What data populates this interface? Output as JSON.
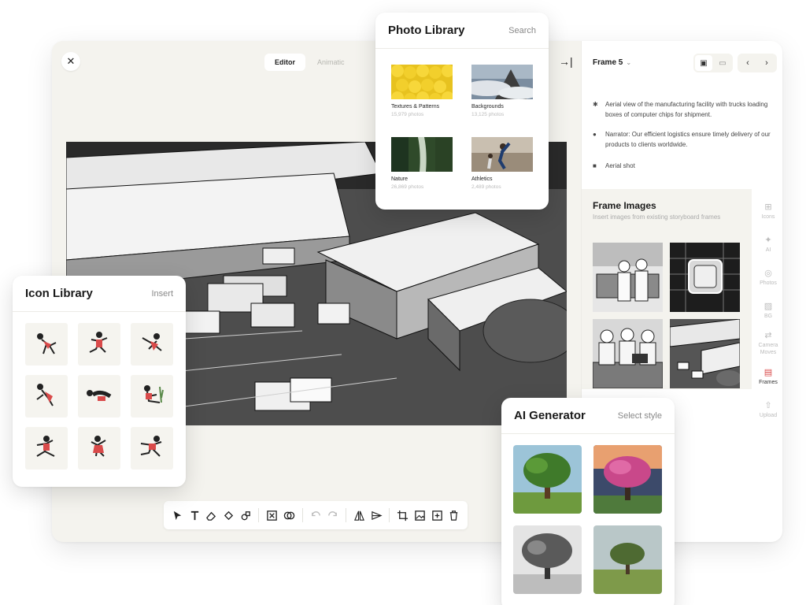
{
  "editor": {
    "close_symbol": "✕",
    "tabs": [
      {
        "label": "Editor",
        "active": true
      },
      {
        "label": "Animatic",
        "active": false
      }
    ],
    "collapse_symbol": "→|"
  },
  "frame_panel": {
    "frame_label": "Frame 5",
    "descriptions": [
      {
        "icon": "action-icon",
        "text": "Aerial view of the manufacturing facility with trucks loading boxes of computer chips for shipment."
      },
      {
        "icon": "microphone-icon",
        "text": "Narrator: Our efficient logistics ensure timely delivery of our products to clients worldwide."
      },
      {
        "icon": "camera-icon",
        "text": "Aerial shot"
      }
    ],
    "frame_images": {
      "title": "Frame Images",
      "subtitle": "Insert images from existing storyboard frames"
    }
  },
  "side_tabs": [
    {
      "label": "Icons",
      "icon": "icons-icon",
      "active": false
    },
    {
      "label": "AI",
      "icon": "sparkle-icon",
      "active": false
    },
    {
      "label": "Photos",
      "icon": "photo-icon",
      "active": false
    },
    {
      "label": "BG",
      "icon": "background-icon",
      "active": false
    },
    {
      "label": "Camera Moves",
      "icon": "camera-move-icon",
      "active": false
    },
    {
      "label": "Frames",
      "icon": "frames-icon",
      "active": true
    },
    {
      "label": "Upload",
      "icon": "upload-icon",
      "active": false
    }
  ],
  "photo_library": {
    "title": "Photo Library",
    "action": "Search",
    "categories": [
      {
        "name": "Textures & Patterns",
        "count": "15,979 photos"
      },
      {
        "name": "Backgrounds",
        "count": "13,125 photos"
      },
      {
        "name": "Nature",
        "count": "26,869 photos"
      },
      {
        "name": "Athletics",
        "count": "2,489 photos"
      }
    ]
  },
  "icon_library": {
    "title": "Icon Library",
    "action": "Insert"
  },
  "ai_generator": {
    "title": "AI Generator",
    "action": "Select style"
  },
  "colors": {
    "accent": "#d94a4a",
    "panel_bg": "#f4f3ee"
  }
}
